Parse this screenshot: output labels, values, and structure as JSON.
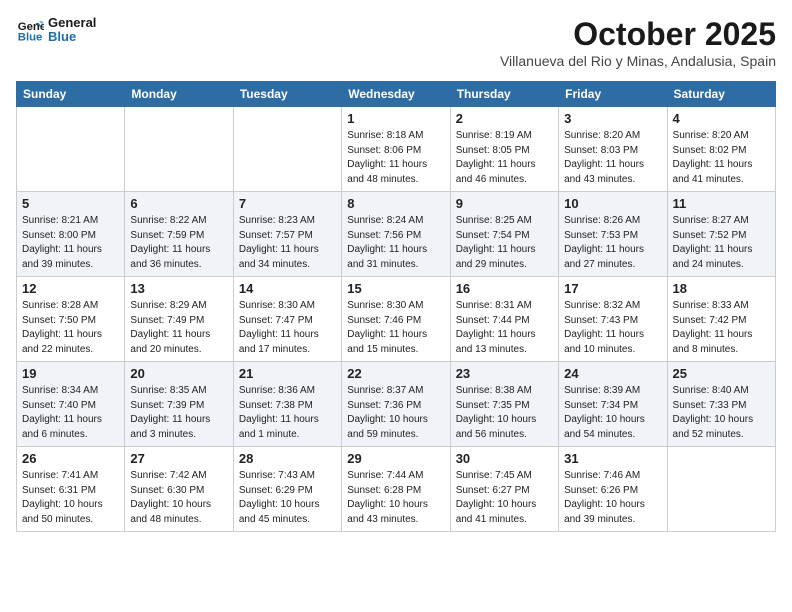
{
  "header": {
    "logo_line1": "General",
    "logo_line2": "Blue",
    "month": "October 2025",
    "location": "Villanueva del Rio y Minas, Andalusia, Spain"
  },
  "days_of_week": [
    "Sunday",
    "Monday",
    "Tuesday",
    "Wednesday",
    "Thursday",
    "Friday",
    "Saturday"
  ],
  "weeks": [
    [
      {
        "day": "",
        "info": ""
      },
      {
        "day": "",
        "info": ""
      },
      {
        "day": "",
        "info": ""
      },
      {
        "day": "1",
        "info": "Sunrise: 8:18 AM\nSunset: 8:06 PM\nDaylight: 11 hours and 48 minutes."
      },
      {
        "day": "2",
        "info": "Sunrise: 8:19 AM\nSunset: 8:05 PM\nDaylight: 11 hours and 46 minutes."
      },
      {
        "day": "3",
        "info": "Sunrise: 8:20 AM\nSunset: 8:03 PM\nDaylight: 11 hours and 43 minutes."
      },
      {
        "day": "4",
        "info": "Sunrise: 8:20 AM\nSunset: 8:02 PM\nDaylight: 11 hours and 41 minutes."
      }
    ],
    [
      {
        "day": "5",
        "info": "Sunrise: 8:21 AM\nSunset: 8:00 PM\nDaylight: 11 hours and 39 minutes."
      },
      {
        "day": "6",
        "info": "Sunrise: 8:22 AM\nSunset: 7:59 PM\nDaylight: 11 hours and 36 minutes."
      },
      {
        "day": "7",
        "info": "Sunrise: 8:23 AM\nSunset: 7:57 PM\nDaylight: 11 hours and 34 minutes."
      },
      {
        "day": "8",
        "info": "Sunrise: 8:24 AM\nSunset: 7:56 PM\nDaylight: 11 hours and 31 minutes."
      },
      {
        "day": "9",
        "info": "Sunrise: 8:25 AM\nSunset: 7:54 PM\nDaylight: 11 hours and 29 minutes."
      },
      {
        "day": "10",
        "info": "Sunrise: 8:26 AM\nSunset: 7:53 PM\nDaylight: 11 hours and 27 minutes."
      },
      {
        "day": "11",
        "info": "Sunrise: 8:27 AM\nSunset: 7:52 PM\nDaylight: 11 hours and 24 minutes."
      }
    ],
    [
      {
        "day": "12",
        "info": "Sunrise: 8:28 AM\nSunset: 7:50 PM\nDaylight: 11 hours and 22 minutes."
      },
      {
        "day": "13",
        "info": "Sunrise: 8:29 AM\nSunset: 7:49 PM\nDaylight: 11 hours and 20 minutes."
      },
      {
        "day": "14",
        "info": "Sunrise: 8:30 AM\nSunset: 7:47 PM\nDaylight: 11 hours and 17 minutes."
      },
      {
        "day": "15",
        "info": "Sunrise: 8:30 AM\nSunset: 7:46 PM\nDaylight: 11 hours and 15 minutes."
      },
      {
        "day": "16",
        "info": "Sunrise: 8:31 AM\nSunset: 7:44 PM\nDaylight: 11 hours and 13 minutes."
      },
      {
        "day": "17",
        "info": "Sunrise: 8:32 AM\nSunset: 7:43 PM\nDaylight: 11 hours and 10 minutes."
      },
      {
        "day": "18",
        "info": "Sunrise: 8:33 AM\nSunset: 7:42 PM\nDaylight: 11 hours and 8 minutes."
      }
    ],
    [
      {
        "day": "19",
        "info": "Sunrise: 8:34 AM\nSunset: 7:40 PM\nDaylight: 11 hours and 6 minutes."
      },
      {
        "day": "20",
        "info": "Sunrise: 8:35 AM\nSunset: 7:39 PM\nDaylight: 11 hours and 3 minutes."
      },
      {
        "day": "21",
        "info": "Sunrise: 8:36 AM\nSunset: 7:38 PM\nDaylight: 11 hours and 1 minute."
      },
      {
        "day": "22",
        "info": "Sunrise: 8:37 AM\nSunset: 7:36 PM\nDaylight: 10 hours and 59 minutes."
      },
      {
        "day": "23",
        "info": "Sunrise: 8:38 AM\nSunset: 7:35 PM\nDaylight: 10 hours and 56 minutes."
      },
      {
        "day": "24",
        "info": "Sunrise: 8:39 AM\nSunset: 7:34 PM\nDaylight: 10 hours and 54 minutes."
      },
      {
        "day": "25",
        "info": "Sunrise: 8:40 AM\nSunset: 7:33 PM\nDaylight: 10 hours and 52 minutes."
      }
    ],
    [
      {
        "day": "26",
        "info": "Sunrise: 7:41 AM\nSunset: 6:31 PM\nDaylight: 10 hours and 50 minutes."
      },
      {
        "day": "27",
        "info": "Sunrise: 7:42 AM\nSunset: 6:30 PM\nDaylight: 10 hours and 48 minutes."
      },
      {
        "day": "28",
        "info": "Sunrise: 7:43 AM\nSunset: 6:29 PM\nDaylight: 10 hours and 45 minutes."
      },
      {
        "day": "29",
        "info": "Sunrise: 7:44 AM\nSunset: 6:28 PM\nDaylight: 10 hours and 43 minutes."
      },
      {
        "day": "30",
        "info": "Sunrise: 7:45 AM\nSunset: 6:27 PM\nDaylight: 10 hours and 41 minutes."
      },
      {
        "day": "31",
        "info": "Sunrise: 7:46 AM\nSunset: 6:26 PM\nDaylight: 10 hours and 39 minutes."
      },
      {
        "day": "",
        "info": ""
      }
    ]
  ]
}
